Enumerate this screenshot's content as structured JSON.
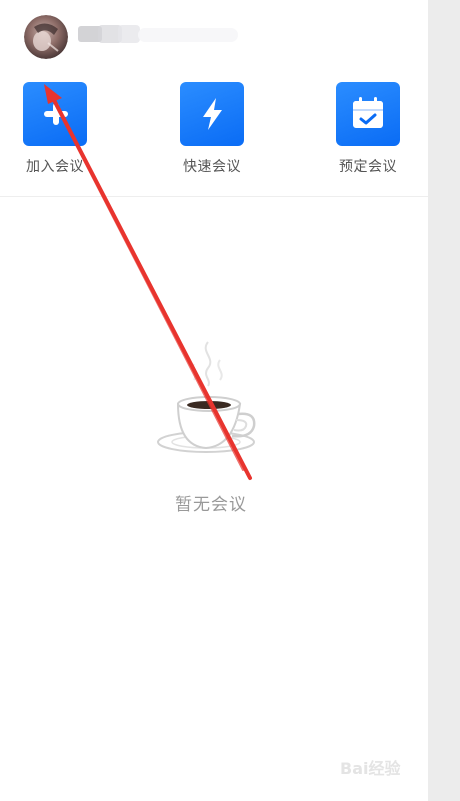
{
  "actions": {
    "join_label": "加入会议",
    "quick_label": "快速会议",
    "schedule_label": "预定会议"
  },
  "empty_state": {
    "text": "暂无会议"
  },
  "watermark": {
    "text": "Bai经验"
  },
  "colors": {
    "accent": "#0a6cf5",
    "annotation": "#e8342e"
  },
  "icons": {
    "join": "plus-icon",
    "quick": "lightning-icon",
    "schedule": "calendar-check-icon",
    "empty": "coffee-cup-icon"
  }
}
